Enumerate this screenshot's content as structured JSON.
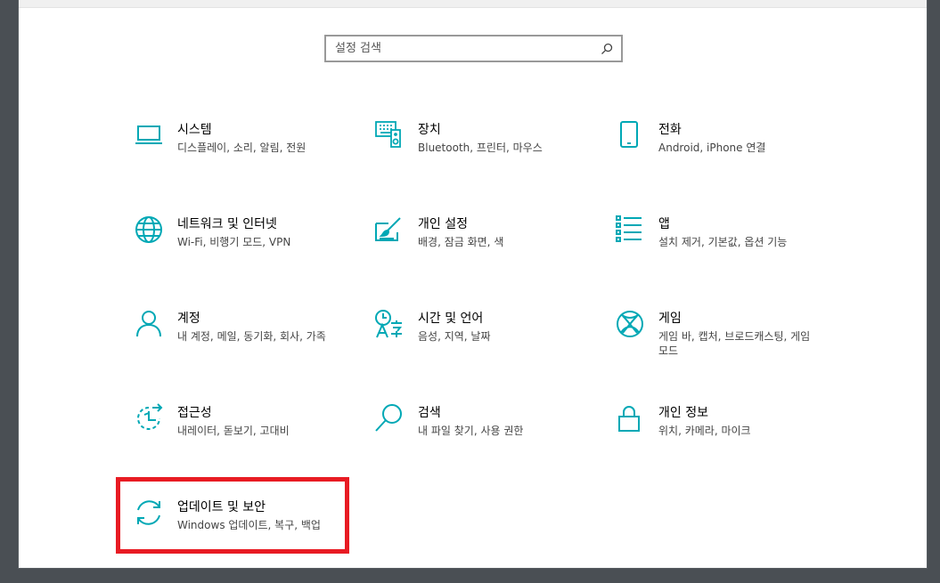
{
  "search": {
    "placeholder": "설정 검색"
  },
  "accent_color": "#00a8b5",
  "highlight_color": "#e81b23",
  "tiles": [
    {
      "icon": "laptop-icon",
      "title": "시스템",
      "desc": "디스플레이, 소리, 알림, 전원"
    },
    {
      "icon": "keyboard-speaker-icon",
      "title": "장치",
      "desc": "Bluetooth, 프린터, 마우스"
    },
    {
      "icon": "phone-icon",
      "title": "전화",
      "desc": "Android, iPhone 연결"
    },
    {
      "icon": "globe-icon",
      "title": "네트워크 및 인터넷",
      "desc": "Wi-Fi, 비행기 모드, VPN"
    },
    {
      "icon": "paint-icon",
      "title": "개인 설정",
      "desc": "배경, 잠금 화면, 색"
    },
    {
      "icon": "apps-list-icon",
      "title": "앱",
      "desc": "설치 제거, 기본값, 옵션 기능"
    },
    {
      "icon": "person-icon",
      "title": "계정",
      "desc": "내 계정, 메일, 동기화, 회사, 가족"
    },
    {
      "icon": "time-language-icon",
      "title": "시간 및 언어",
      "desc": "음성, 지역, 날짜"
    },
    {
      "icon": "xbox-icon",
      "title": "게임",
      "desc": "게임 바, 캡처, 브로드캐스팅, 게임 모드"
    },
    {
      "icon": "accessibility-icon",
      "title": "접근성",
      "desc": "내레이터, 돋보기, 고대비"
    },
    {
      "icon": "magnifier-icon",
      "title": "검색",
      "desc": "내 파일 찾기, 사용 권한"
    },
    {
      "icon": "lock-icon",
      "title": "개인 정보",
      "desc": "위치, 카메라, 마이크"
    },
    {
      "icon": "sync-icon",
      "title": "업데이트 및 보안",
      "desc": "Windows 업데이트, 복구, 백업"
    }
  ]
}
